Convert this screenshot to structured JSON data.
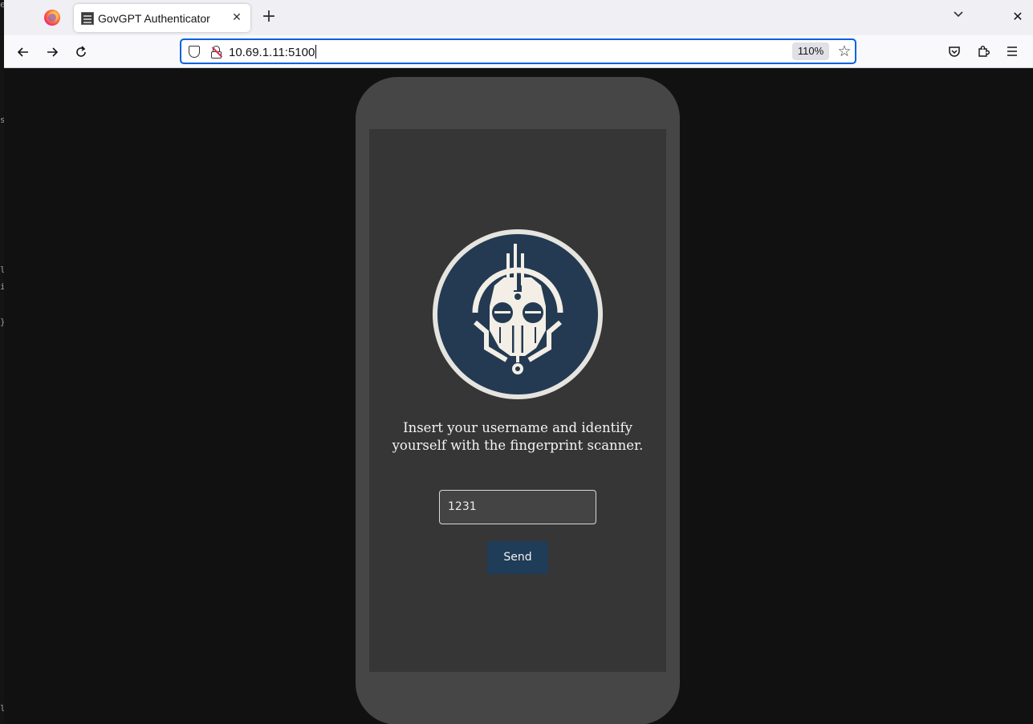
{
  "browser": {
    "tab": {
      "title": "GovGPT Authenticator"
    },
    "url": "10.69.1.11:5100",
    "zoom": "110%"
  },
  "page": {
    "prompt": "Insert your username and identify yourself with the fingerprint scanner.",
    "username_value": "1231",
    "send_label": "Send"
  },
  "colors": {
    "logo_badge": "#243a52",
    "logo_ring": "#e6e4df",
    "send_button": "#1f3c59",
    "phone_frame": "#464646",
    "phone_screen": "#363636"
  }
}
